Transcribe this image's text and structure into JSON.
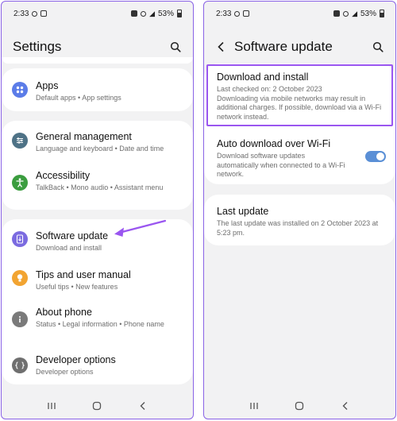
{
  "left": {
    "status": {
      "time": "2:33",
      "battery": "53%"
    },
    "title": "Settings",
    "items": [
      {
        "title": "Apps",
        "subtitle": "Default apps  •  App settings",
        "icon": "apps-icon",
        "color": "#5b7ce8"
      },
      {
        "title": "General management",
        "subtitle": "Language and keyboard  •  Date and time",
        "icon": "sliders-icon",
        "color": "#4e7286"
      },
      {
        "title": "Accessibility",
        "subtitle": "TalkBack  •  Mono audio  •  Assistant menu",
        "icon": "accessibility-icon",
        "color": "#3b9d3f"
      },
      {
        "title": "Software update",
        "subtitle": "Download and install",
        "icon": "software-update-icon",
        "color": "#7b6be0"
      },
      {
        "title": "Tips and user manual",
        "subtitle": "Useful tips  •  New features",
        "icon": "lightbulb-icon",
        "color": "#f2a431"
      },
      {
        "title": "About phone",
        "subtitle": "Status  •  Legal information  •  Phone name",
        "icon": "info-icon",
        "color": "#7a7a7a"
      },
      {
        "title": "Developer options",
        "subtitle": "Developer options",
        "icon": "code-braces-icon",
        "color": "#6f6f6f"
      }
    ]
  },
  "right": {
    "status": {
      "time": "2:33",
      "battery": "53%"
    },
    "title": "Software update",
    "download": {
      "title": "Download and install",
      "sub1": "Last checked on: 2 October 2023",
      "sub2": "Downloading via mobile networks may result in additional charges. If possible, download via a Wi-Fi network instead."
    },
    "auto": {
      "title": "Auto download over Wi-Fi",
      "sub": "Download software updates automatically when connected to a Wi-Fi network.",
      "enabled": true
    },
    "last": {
      "title": "Last update",
      "sub": "The last update was installed on 2 October 2023 at 5:23 pm."
    }
  },
  "colors": {
    "accent": "#9a56f0",
    "toggle": "#5a8fd6"
  }
}
